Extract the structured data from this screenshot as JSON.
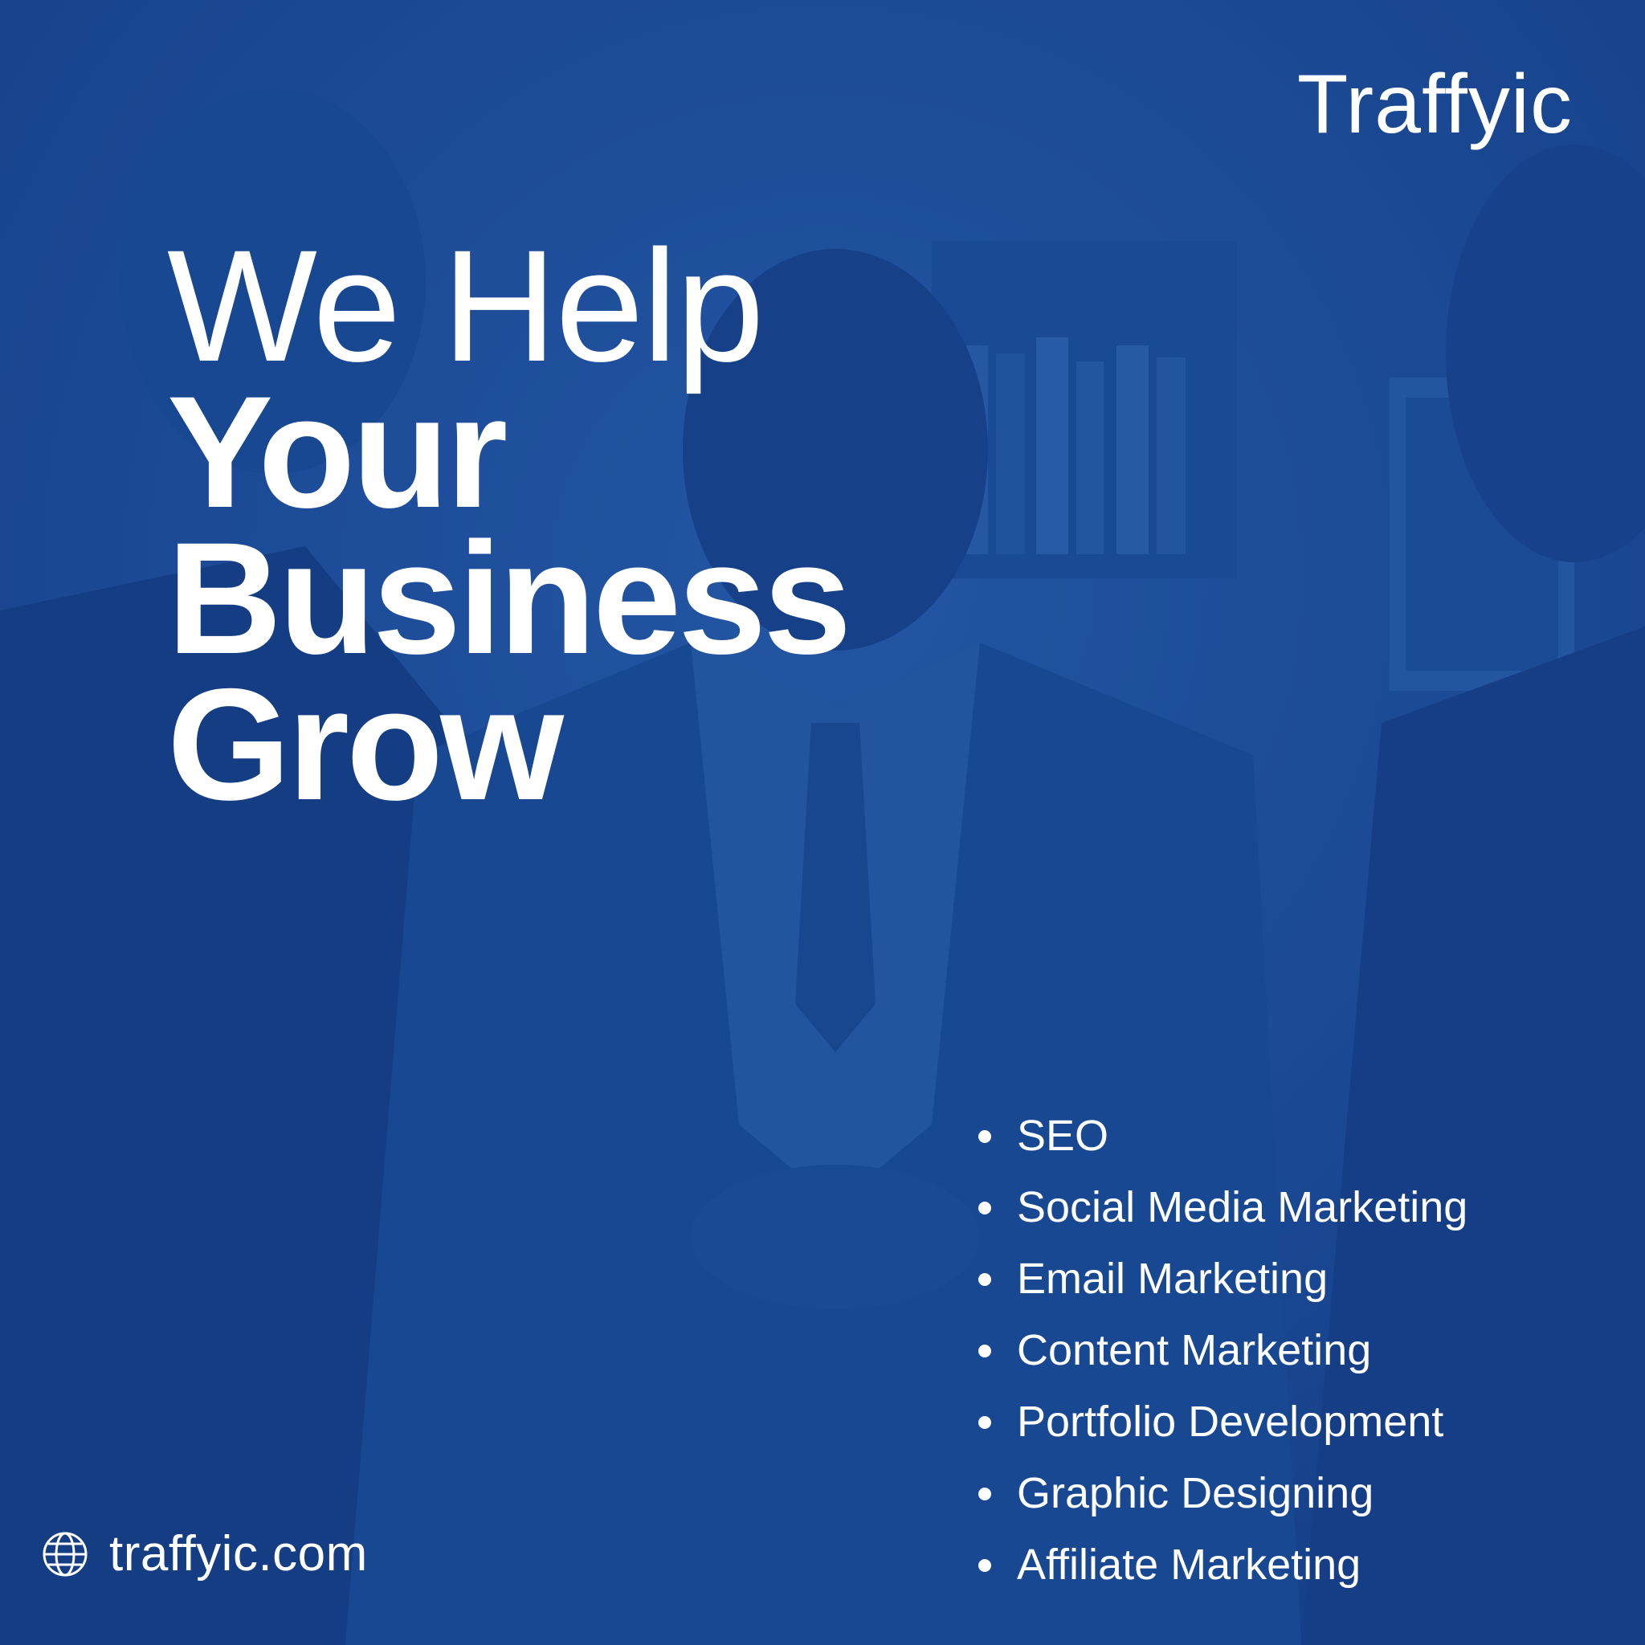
{
  "brand": {
    "name": "Traffyic"
  },
  "headline": {
    "line1": "We Help",
    "line2": "Your",
    "line3": "Business",
    "line4": "Grow"
  },
  "services": [
    "SEO",
    "Social Media Marketing",
    "Email Marketing",
    "Content Marketing",
    "Portfolio Development",
    "Graphic Designing",
    "Affiliate Marketing"
  ],
  "footer": {
    "icon": "globe-icon",
    "website": "traffyic.com"
  },
  "colors": {
    "background": "#1a4b94",
    "text": "#ffffff"
  }
}
